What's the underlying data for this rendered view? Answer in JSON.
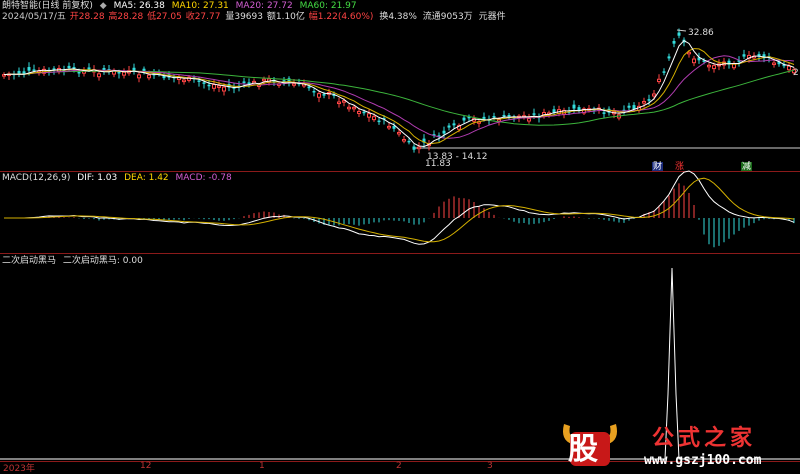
{
  "header": {
    "title": "朗特智能(日线 前复权)",
    "ma5": "MA5: 26.38",
    "ma10": "MA10: 27.31",
    "ma20": "MA20: 27.72",
    "ma60": "MA60: 21.97",
    "date": "2024/05/17/五",
    "open": "开28.28",
    "high": "高28.28",
    "low": "低27.05",
    "close": "收27.77",
    "volume": "量39693",
    "amount": "额1.10亿",
    "change": "幅1.22(4.60%)",
    "turnover": "换4.38%",
    "float": "流通9053万",
    "industry": "元器件"
  },
  "price_annotations": {
    "high_label": "32.86",
    "low_label": "11.83",
    "range_label": "13.83 - 14.12",
    "right_edge_label": "2",
    "tags": [
      "财",
      "涨",
      "减"
    ]
  },
  "macd": {
    "title": "MACD(12,26,9)",
    "dif": "DIF: 1.03",
    "dea": "DEA: 1.42",
    "macd": "MACD: -0.78"
  },
  "indicator2": {
    "title": "二次启动黑马",
    "value_label": "二次启动黑马: 0.00"
  },
  "xaxis": {
    "ticks": [
      "2023年",
      "12",
      "1",
      "2",
      "3"
    ]
  },
  "watermark": {
    "logo_char": "股",
    "name": "公式之家",
    "url": "www.gszj100.com"
  },
  "colors": {
    "ma5": "#ffffff",
    "ma10": "#ffd700",
    "ma20": "#cc44cc",
    "ma60": "#44cc44",
    "up": "#ff4444",
    "down": "#33dddd",
    "separator": "#8b1a1a"
  }
}
